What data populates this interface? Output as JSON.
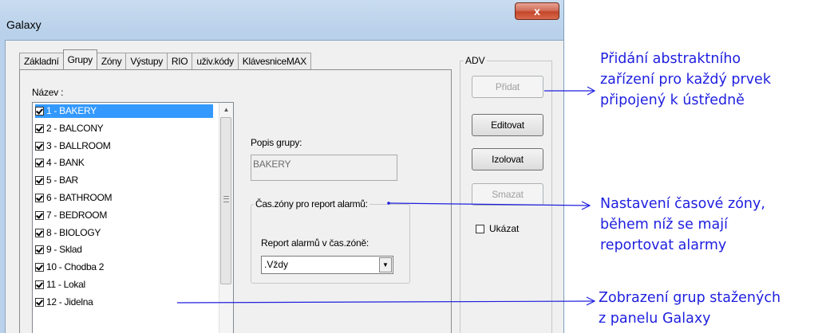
{
  "window": {
    "title": "Galaxy",
    "close_label": "x"
  },
  "tabs": [
    "Základní",
    "Grupy",
    "Zóny",
    "Výstupy",
    "RIO",
    "uživ.kódy",
    "KlávesniceMAX"
  ],
  "active_tab_index": 1,
  "groups_panel": {
    "name_label": "Název :",
    "items": [
      "1 - BAKERY",
      "2 - BALCONY",
      "3 - BALLROOM",
      "4 - BANK",
      "5 - BAR",
      "6 - BATHROOM",
      "7 - BEDROOM",
      "8 - BIOLOGY",
      "9 - Sklad",
      "10 - Chodba 2",
      "11 - Lokal",
      "12 - Jidelna"
    ],
    "selected_index": 0
  },
  "description": {
    "label": "Popis grupy:",
    "value": "BAKERY"
  },
  "alarm_zone": {
    "group_title": "Čas.zóny pro report alarmů:",
    "field_label": "Report alarmů v čas.zóně:",
    "selected": ".Vždy"
  },
  "adv": {
    "title": "ADV",
    "add_label": "Přidat",
    "edit_label": "Editovat",
    "isolate_label": "Izolovat",
    "delete_label": "Smazat",
    "show_label": "Ukázat"
  },
  "annotations": {
    "add_device": [
      "Přidání abstraktního",
      "zařízení pro každý prvek",
      "připojený k ústředně"
    ],
    "time_zone": [
      "Nastavení časové zóny,",
      "během níž se mají",
      "reportovat alarmy"
    ],
    "groups": [
      "Zobrazení grup stažených",
      "z panelu Galaxy"
    ]
  },
  "colors": {
    "annotation": "#1f1fe0",
    "selection": "#3399ff",
    "close_button": "#c4462a"
  }
}
